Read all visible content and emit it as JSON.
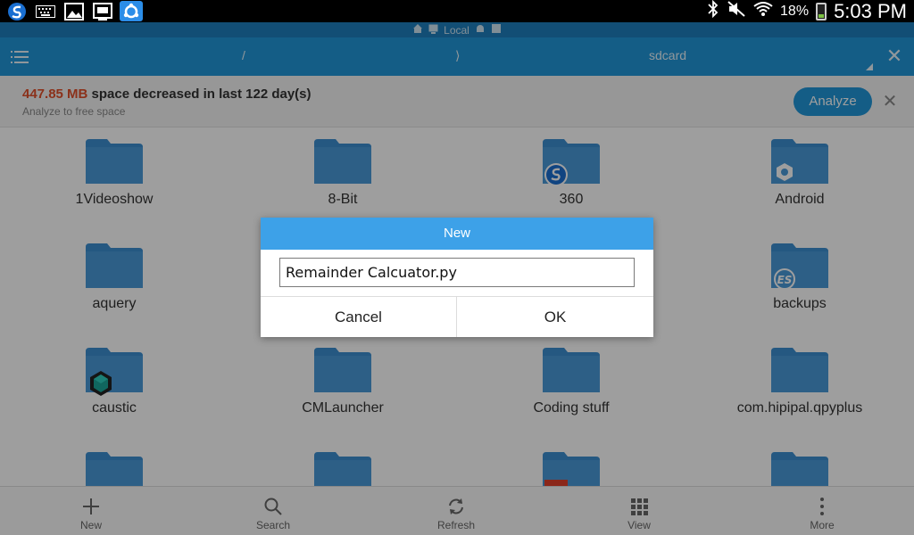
{
  "status_bar": {
    "battery": "18%",
    "time": "5:03 PM",
    "left_icons": [
      "s-app-icon",
      "keyboard-icon",
      "gallery-icon",
      "screenshot-icon",
      "sync-app-icon"
    ],
    "right_icons": [
      "bluetooth-icon",
      "mute-icon",
      "wifi-icon"
    ]
  },
  "header": {
    "location_label": "Local",
    "path_root": "/",
    "path_sep": "⟩",
    "path_current": "sdcard"
  },
  "banner": {
    "size": "447.85 MB",
    "message": "space decreased in last 122 day(s)",
    "subtitle": "Analyze to free space",
    "analyze_label": "Analyze"
  },
  "folders": [
    {
      "name": "1Videoshow",
      "badge": ""
    },
    {
      "name": "8-Bit",
      "badge": ""
    },
    {
      "name": "360",
      "badge": "360-icon"
    },
    {
      "name": "Android",
      "badge": "gear-icon"
    },
    {
      "name": "aquery",
      "badge": ""
    },
    {
      "name": "backups",
      "badge": "es-icon"
    },
    {
      "name": "caustic",
      "badge": "caustic-icon"
    },
    {
      "name": "CMLauncher",
      "badge": ""
    },
    {
      "name": "Coding stuff",
      "badge": ""
    },
    {
      "name": "com.hipipal.qpyplus",
      "badge": ""
    }
  ],
  "bottom_bar": {
    "new": "New",
    "search": "Search",
    "refresh": "Refresh",
    "view": "View",
    "more": "More"
  },
  "dialog": {
    "title": "New",
    "input_value": "Remainder Calcuator.py",
    "cancel_label": "Cancel",
    "ok_label": "OK"
  },
  "colors": {
    "toolbar": "#2196d8",
    "folder": "#3d8fd1",
    "dialog_title": "#3da1e8",
    "highlight": "#e0502b"
  }
}
